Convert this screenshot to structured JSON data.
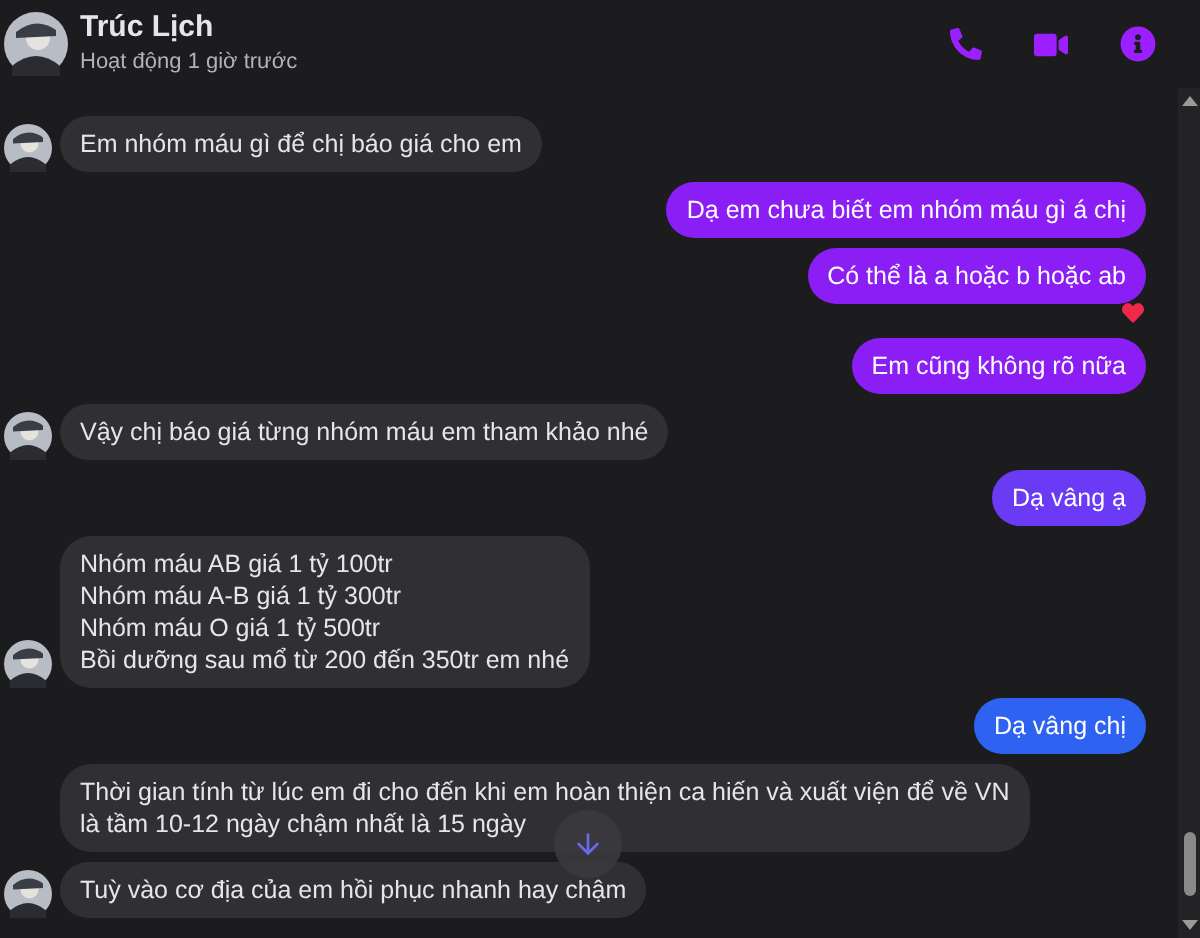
{
  "header": {
    "name": "Trúc Lịch",
    "status": "Hoạt động 1 giờ trước"
  },
  "messages": [
    {
      "kind": "them",
      "avatar": true,
      "heart": false,
      "lines": [
        "Em nhóm máu gì để chị báo giá cho em"
      ]
    },
    {
      "kind": "me",
      "color": "#8a1ef5",
      "heart": false,
      "lines": [
        "Dạ em chưa biết em nhóm máu gì á chị"
      ]
    },
    {
      "kind": "me",
      "color": "#8a1ef5",
      "heart": true,
      "lines": [
        "Có thể là a hoặc b hoặc ab"
      ]
    },
    {
      "kind": "me",
      "color": "#8a1ef5",
      "heart": false,
      "lines": [
        "Em cũng không rõ nữa"
      ]
    },
    {
      "kind": "them",
      "avatar": true,
      "heart": false,
      "lines": [
        "Vậy chị báo giá từng nhóm máu em tham khảo nhé"
      ]
    },
    {
      "kind": "me",
      "color": "#6a3af5",
      "heart": false,
      "lines": [
        "Dạ vâng ạ"
      ]
    },
    {
      "kind": "them",
      "avatar": true,
      "heart": false,
      "lines": [
        "Nhóm máu AB giá 1 tỷ 100tr",
        "Nhóm máu A-B giá 1 tỷ 300tr",
        "Nhóm máu O giá 1 tỷ 500tr",
        "Bồi dưỡng sau mổ từ 200 đến 350tr em nhé"
      ]
    },
    {
      "kind": "me",
      "color": "#2e62f0",
      "heart": false,
      "lines": [
        "Dạ vâng chị"
      ]
    },
    {
      "kind": "them",
      "avatar": false,
      "heart": false,
      "lines": [
        "Thời gian tính từ lúc em đi cho đến khi em hoàn thiện ca hiến và xuất viện để về VN",
        "là tầm 10-12 ngày chậm nhất là 15 ngày"
      ]
    },
    {
      "kind": "them",
      "avatar": true,
      "heart": false,
      "lines": [
        "Tuỳ vào cơ địa của em hồi phục nhanh hay chậm"
      ]
    }
  ]
}
